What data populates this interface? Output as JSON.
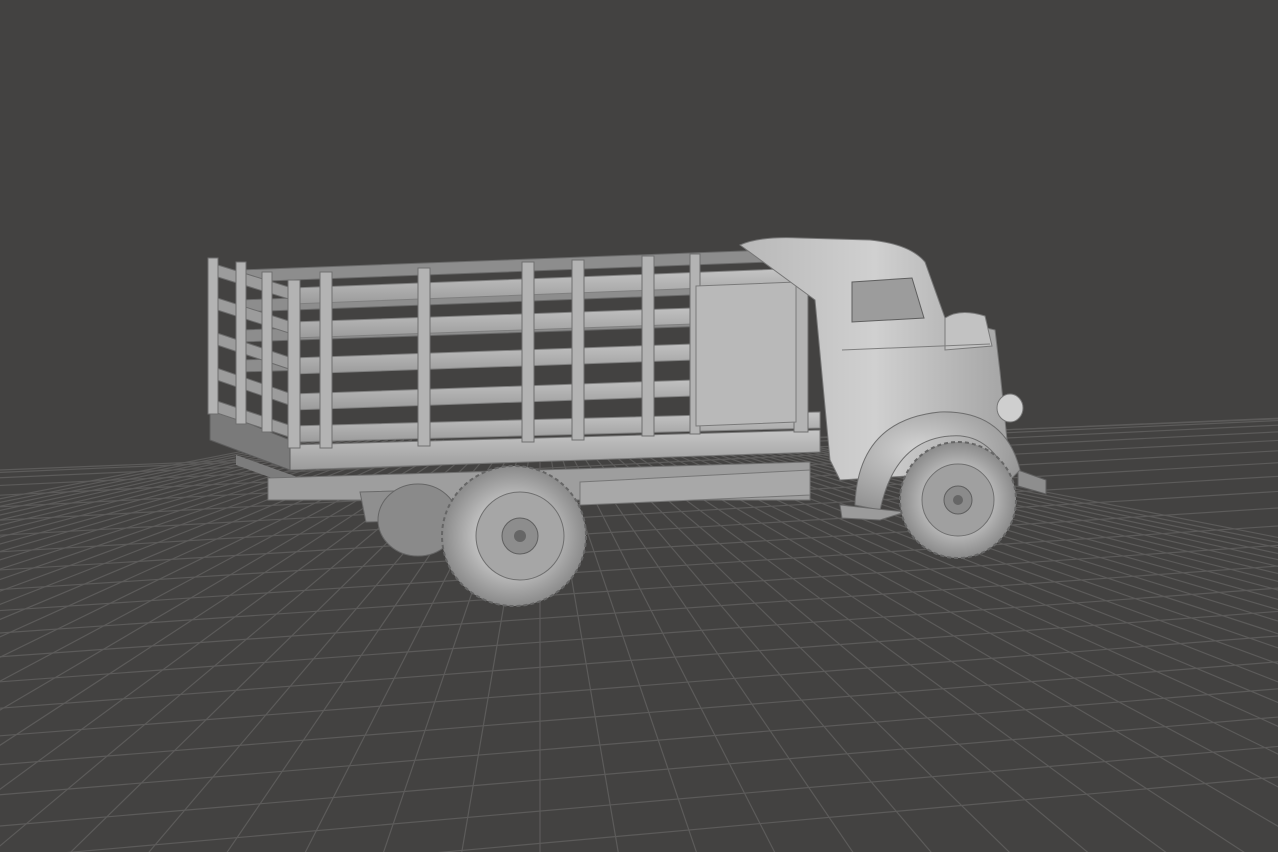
{
  "viewport": {
    "background_color": "#434241",
    "grid_color": "#5c5b5a",
    "model_color": "#a9a9a9",
    "model_highlight_color": "#c8c8c8",
    "model_shadow_color": "#5f5f5f",
    "show_grid": true,
    "icon": "3d-model-icon"
  }
}
